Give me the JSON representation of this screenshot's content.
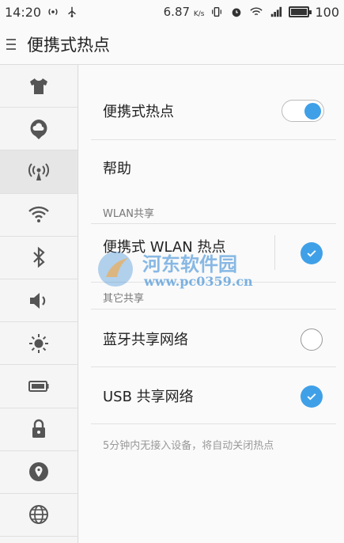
{
  "status_bar": {
    "time": "14:20",
    "speed": "6.87",
    "speed_unit": "K/s",
    "battery": "100",
    "battery_level_pct": 100
  },
  "title_bar": {
    "title": "便携式热点"
  },
  "sidebar": {
    "items": [
      {
        "icon": "shirt-icon"
      },
      {
        "icon": "cloud-icon"
      },
      {
        "icon": "hotspot-icon",
        "active": true
      },
      {
        "icon": "wifi-icon"
      },
      {
        "icon": "bluetooth-icon"
      },
      {
        "icon": "volume-icon"
      },
      {
        "icon": "brightness-icon"
      },
      {
        "icon": "battery-icon"
      },
      {
        "icon": "lock-icon"
      },
      {
        "icon": "location-icon"
      },
      {
        "icon": "globe-icon"
      }
    ]
  },
  "main": {
    "hotspot_toggle_label": "便携式热点",
    "hotspot_enabled": true,
    "help_label": "帮助",
    "wlan_section": "WLAN共享",
    "wlan_hotspot_label": "便携式 WLAN 热点",
    "wlan_hotspot_checked": true,
    "other_section": "其它共享",
    "bluetooth_share_label": "蓝牙共享网络",
    "bluetooth_share_checked": false,
    "usb_share_label": "USB 共享网络",
    "usb_share_checked": true,
    "footer_note": "5分钟内无接入设备，将自动关闭热点"
  },
  "watermark": {
    "name": "河东软件园",
    "url": "www.pc0359.cn"
  },
  "colors": {
    "accent": "#3fa0e8",
    "background": "#fafafa"
  }
}
